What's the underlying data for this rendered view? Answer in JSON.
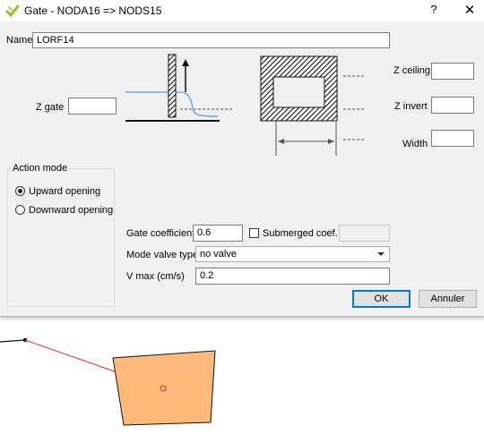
{
  "window": {
    "title": "Gate - NODA16 => NODS15",
    "help_label": "?",
    "close_label": "✕",
    "icon": "qgis-logo-icon"
  },
  "form": {
    "name_label": "Name",
    "name_value": "LORF14",
    "z_gate_label": "Z gate",
    "z_gate_value": "",
    "z_ceiling_label": "Z ceiling",
    "z_ceiling_value": "",
    "z_invert_label": "Z invert",
    "z_invert_value": "",
    "width_label": "Width",
    "width_value": ""
  },
  "action_mode": {
    "title": "Action mode",
    "options": [
      {
        "label": "Upward opening",
        "checked": true
      },
      {
        "label": "Downward opening",
        "checked": false
      }
    ]
  },
  "params": {
    "gate_coef_label": "Gate coefficient",
    "gate_coef_value": "0.6",
    "submerged_label": "Submerged coef.",
    "submerged_checked": false,
    "submerged_value": "",
    "valve_label": "Mode valve type",
    "valve_value": "no valve",
    "vmax_label": "V max (cm/s)",
    "vmax_value": "0.2"
  },
  "buttons": {
    "ok": "OK",
    "cancel": "Annuler"
  },
  "colors": {
    "dialog_bg": "#f0f0f0",
    "accent": "#0078d7",
    "water": "#6fa8dc",
    "polygon_fill": "#ffb97b",
    "link_line": "#e8352b"
  }
}
